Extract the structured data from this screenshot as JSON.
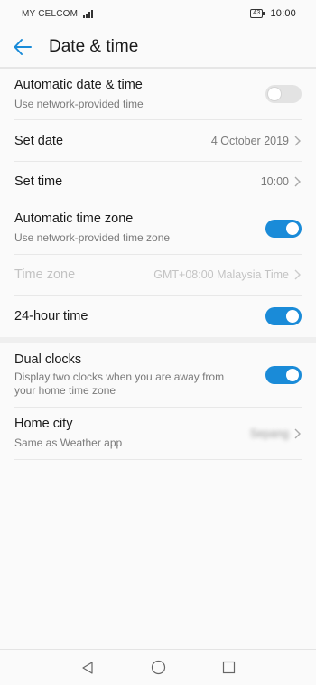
{
  "status_bar": {
    "carrier": "MY CELCOM",
    "battery": "43",
    "time": "10:00"
  },
  "header": {
    "title": "Date & time",
    "back_icon": "back-arrow-icon"
  },
  "settings": {
    "auto_date": {
      "title": "Automatic date & time",
      "subtitle": "Use network-provided time",
      "enabled": false
    },
    "set_date": {
      "title": "Set date",
      "value": "4 October 2019"
    },
    "set_time": {
      "title": "Set time",
      "value": "10:00"
    },
    "auto_zone": {
      "title": "Automatic time zone",
      "subtitle": "Use network-provided time zone",
      "enabled": true
    },
    "time_zone": {
      "title": "Time zone",
      "value": "GMT+08:00 Malaysia Time",
      "disabled": true
    },
    "hour24": {
      "title": "24-hour time",
      "enabled": true
    },
    "dual_clocks": {
      "title": "Dual clocks",
      "subtitle": "Display two clocks when you are away from your home time zone",
      "enabled": true
    },
    "home_city": {
      "title": "Home city",
      "subtitle": "Same as Weather app",
      "value": "Sepang"
    }
  },
  "nav": {
    "back": "nav-back-icon",
    "home": "nav-home-icon",
    "recents": "nav-recents-icon"
  },
  "colors": {
    "accent": "#1a8bd8",
    "toggle_off": "#e3e3e3"
  }
}
